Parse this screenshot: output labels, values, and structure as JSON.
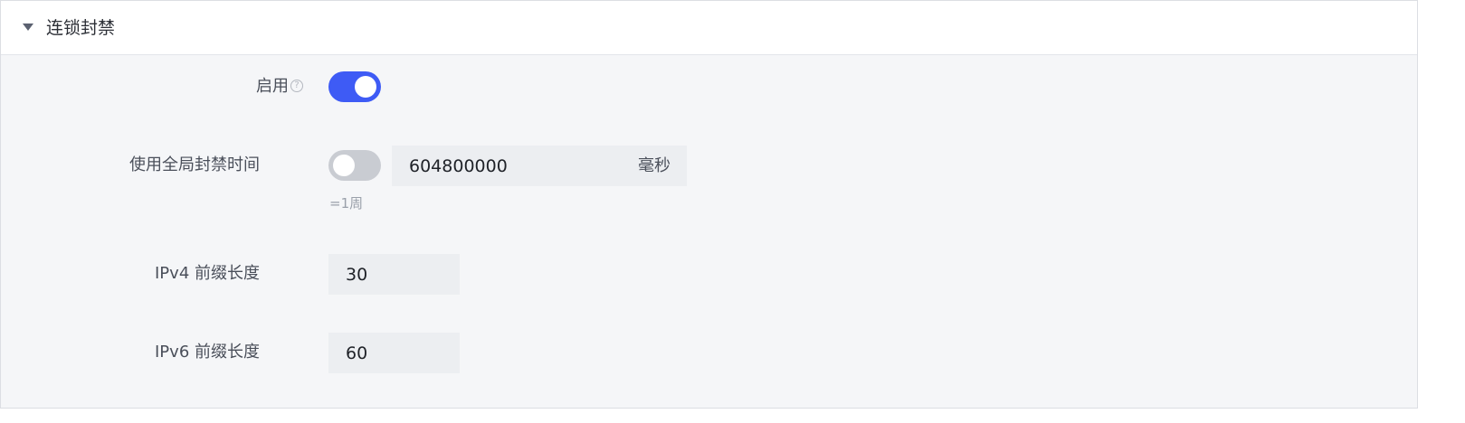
{
  "section": {
    "title": "连锁封禁",
    "expanded_icon": "caret-down-icon"
  },
  "fields": {
    "enable": {
      "label": "启用",
      "help_icon": "question-circle-icon",
      "help_glyph": "?",
      "toggle_on": true
    },
    "global_ban_time": {
      "label": "使用全局封禁时间",
      "toggle_on": false,
      "value": "604800000",
      "unit": "毫秒",
      "hint": "=1周"
    },
    "ipv4_prefix": {
      "label": "IPv4 前缀长度",
      "value": "30"
    },
    "ipv6_prefix": {
      "label": "IPv6 前缀长度",
      "value": "60"
    }
  },
  "colors": {
    "accent": "#3e5bf5",
    "toggle_off": "#c9ccd2",
    "panel_bg": "#f5f6f8",
    "input_bg": "#eceef1"
  }
}
